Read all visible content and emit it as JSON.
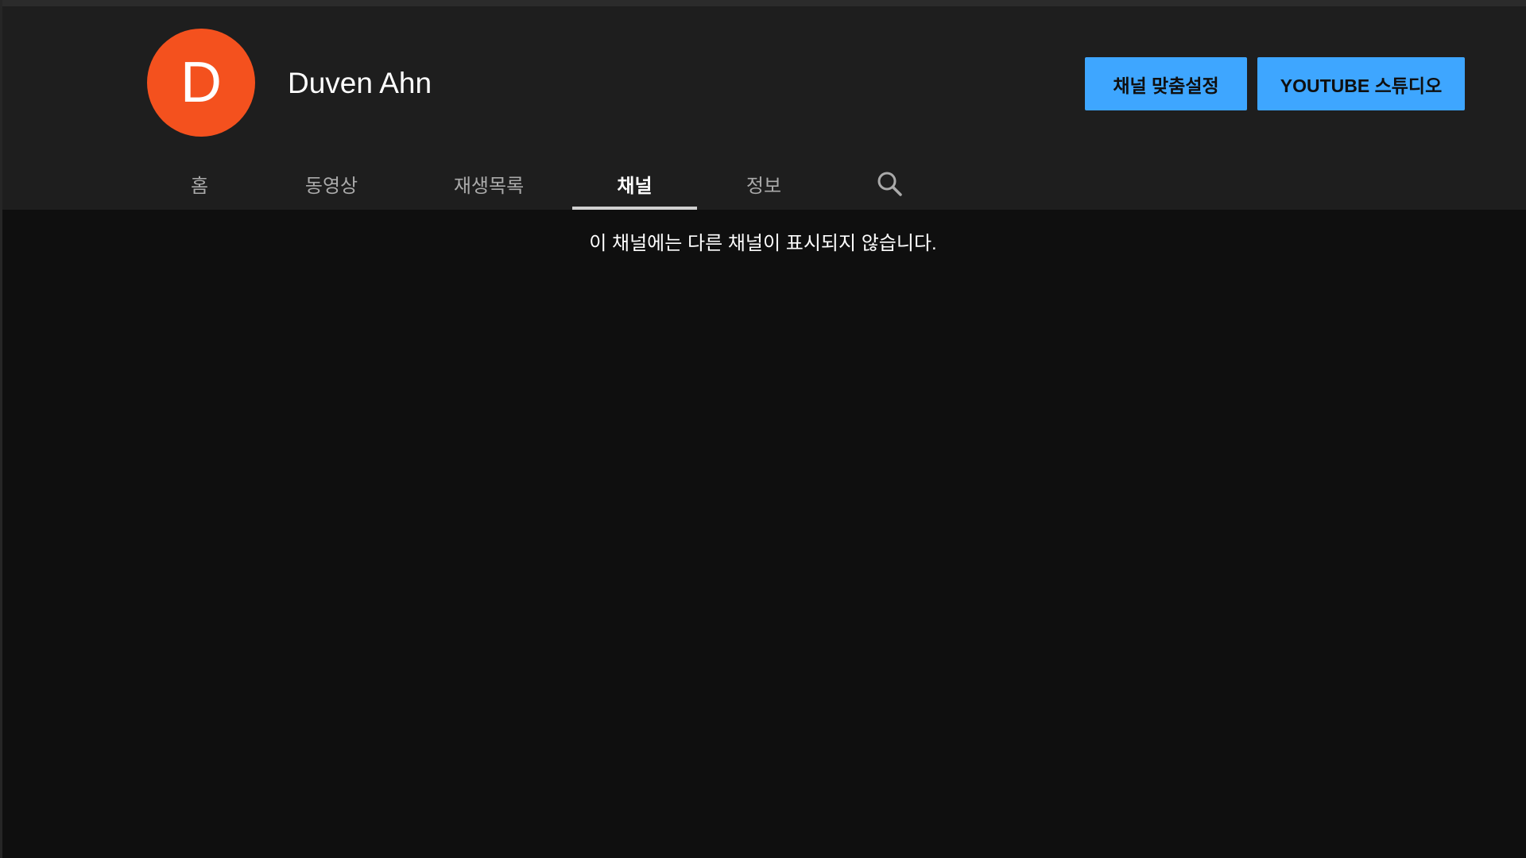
{
  "channel": {
    "avatar_letter": "D",
    "avatar_color": "#f4511e",
    "name": "Duven Ahn"
  },
  "header_buttons": {
    "customize_label": "채널 맞춤설정",
    "studio_label": "YOUTUBE 스튜디오",
    "accent_color": "#3ea6ff"
  },
  "tabs": [
    {
      "label": "홈",
      "active": false
    },
    {
      "label": "동영상",
      "active": false
    },
    {
      "label": "재생목록",
      "active": false
    },
    {
      "label": "채널",
      "active": true
    },
    {
      "label": "정보",
      "active": false
    }
  ],
  "tab_search_icon": "search-icon",
  "content": {
    "empty_message": "이 채널에는 다른 채널이 표시되지 않습니다."
  }
}
